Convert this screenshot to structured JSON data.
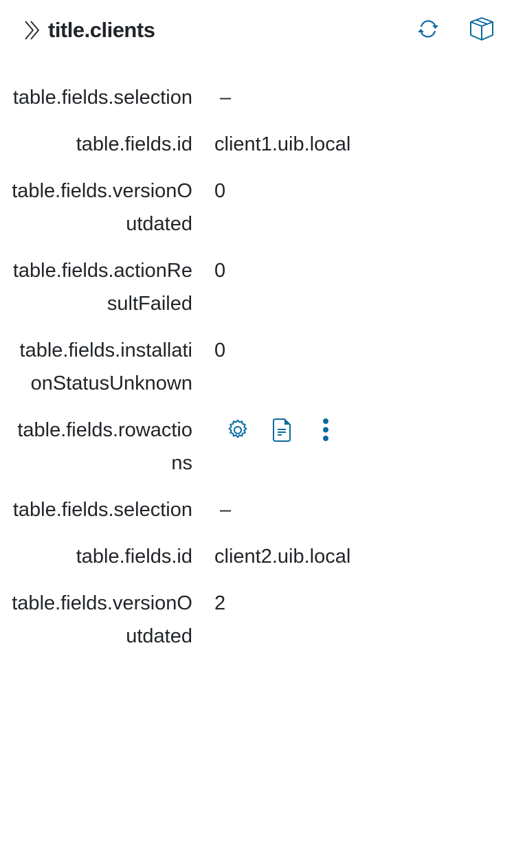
{
  "header": {
    "title": "title.clients",
    "icons": [
      "chevrons-right-icon",
      "refresh-icon",
      "box-icon"
    ]
  },
  "accent": "#0b6a9f",
  "rows": [
    {
      "label": "table.fields.selection",
      "value": "–"
    },
    {
      "label": "table.fields.id",
      "value": "client1.uib.local"
    },
    {
      "label": "table.fields.versionOutdated",
      "value": "0"
    },
    {
      "label": "table.fields.actionResultFailed",
      "value": "0"
    },
    {
      "label": "table.fields.installationStatusUnknown",
      "value": "0"
    },
    {
      "label": "table.fields.rowactions",
      "icons": [
        "gear-icon",
        "document-icon",
        "more-vertical-icon"
      ]
    },
    {
      "label": "table.fields.selection",
      "value": "–"
    },
    {
      "label": "table.fields.id",
      "value": "client2.uib.local"
    },
    {
      "label": "table.fields.versionOutdated",
      "value": "2"
    }
  ]
}
